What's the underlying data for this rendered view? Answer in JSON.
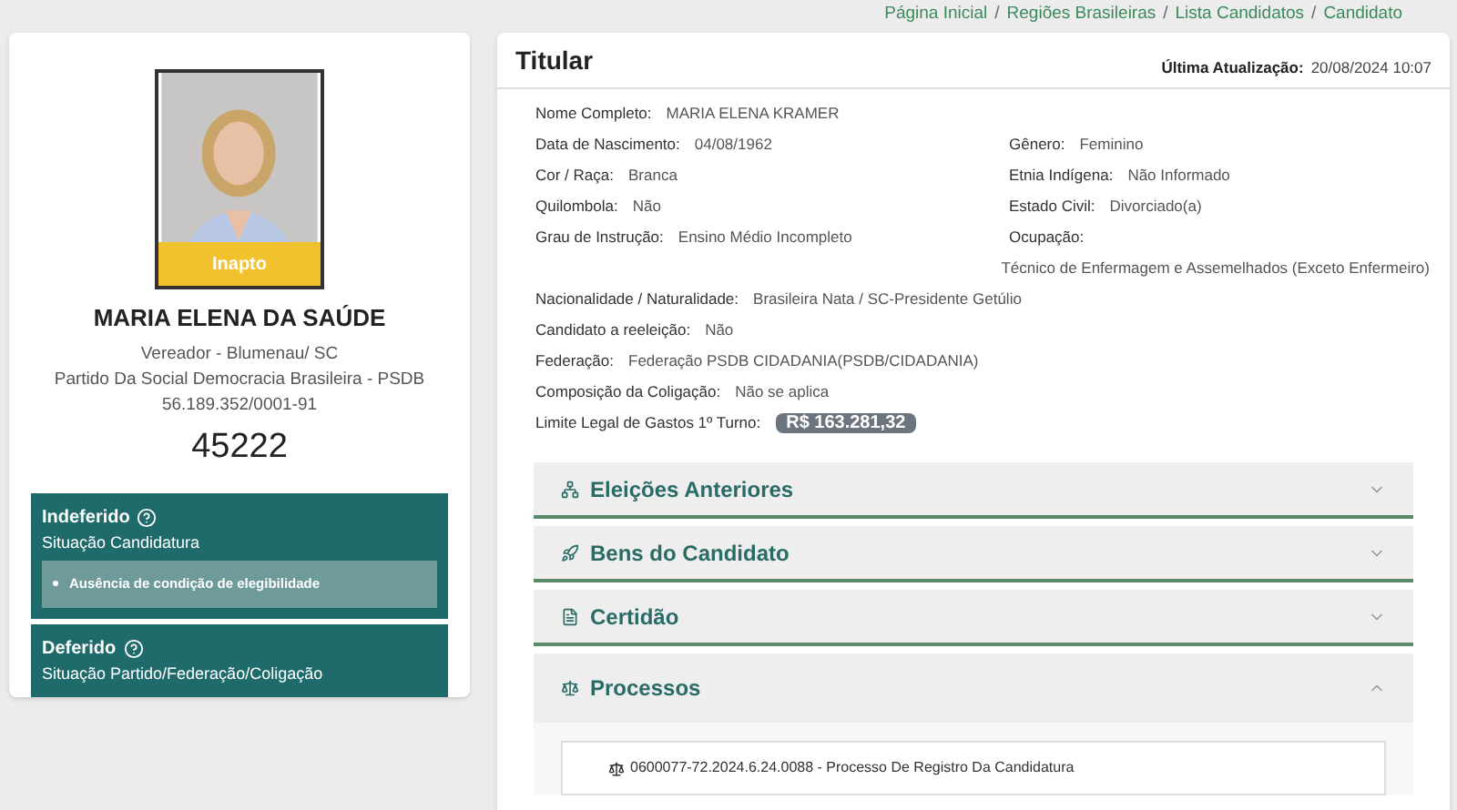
{
  "breadcrumb": {
    "separator": "/",
    "items": [
      "Página Inicial",
      "Regiões Brasileiras",
      "Lista Candidatos",
      "Candidato"
    ]
  },
  "candidate": {
    "status_badge": "Inapto",
    "name": "MARIA ELENA DA SAÚDE",
    "role": "Vereador - Blumenau/ SC",
    "party": "Partido Da Social Democracia Brasileira - PSDB",
    "cnpj": "56.189.352/0001-91",
    "number": "45222"
  },
  "situations": [
    {
      "title": "Indeferido",
      "subtitle": "Situação Candidatura",
      "reasons": [
        "Ausência de condição de elegibilidade"
      ]
    },
    {
      "title": "Deferido",
      "subtitle": "Situação Partido/Federação/Coligação"
    }
  ],
  "details": {
    "title": "Titular",
    "updated_label": "Última Atualização:",
    "updated_value": "20/08/2024 10:07",
    "rows": [
      [
        {
          "label": "Nome Completo:",
          "value": "MARIA ELENA KRAMER",
          "kind": "text"
        }
      ],
      [
        {
          "label": "Data de Nascimento:",
          "value": "04/08/1962",
          "kind": "text"
        },
        {
          "label": "Gênero:",
          "value": "Feminino",
          "kind": "text"
        }
      ],
      [
        {
          "label": "Cor / Raça:",
          "value": "Branca",
          "kind": "text"
        },
        {
          "label": "Etnia Indígena:",
          "value": "Não Informado",
          "kind": "text"
        }
      ],
      [
        {
          "label": "Quilombola:",
          "value": "Não",
          "kind": "text"
        },
        {
          "label": "Estado Civil:",
          "value": "Divorciado(a)",
          "kind": "text"
        }
      ],
      [
        {
          "label": "Grau de Instrução:",
          "value": "Ensino Médio Incompleto",
          "kind": "text"
        },
        {
          "label": "Ocupação:",
          "value": "Técnico de Enfermagem e Assemelhados (Exceto Enfermeiro)",
          "kind": "below"
        }
      ],
      [
        {
          "label": "Nacionalidade / Naturalidade:",
          "value": "Brasileira Nata / SC-Presidente Getúlio",
          "kind": "text"
        }
      ],
      [
        {
          "label": "Candidato a reeleição:",
          "value": "Não",
          "kind": "text"
        }
      ],
      [
        {
          "label": "Federação:",
          "value": "Federação PSDB CIDADANIA(PSDB/CIDADANIA)",
          "kind": "text"
        }
      ],
      [
        {
          "label": "Composição da Coligação:",
          "value": "Não se aplica",
          "kind": "text"
        }
      ],
      [
        {
          "label": "Limite Legal de Gastos 1º Turno:",
          "value": "R$ 163.281,32",
          "kind": "badge"
        }
      ]
    ]
  },
  "sections": [
    {
      "title": "Eleições Anteriores",
      "kind": "sitemap",
      "expanded": false
    },
    {
      "title": "Bens do Candidato",
      "kind": "rocket",
      "expanded": false
    },
    {
      "title": "Certidão",
      "kind": "file",
      "expanded": false
    },
    {
      "title": "Processos",
      "kind": "scale",
      "expanded": true,
      "items": [
        "0600077-72.2024.6.24.0088 - Processo De Registro Da Candidatura"
      ]
    }
  ]
}
